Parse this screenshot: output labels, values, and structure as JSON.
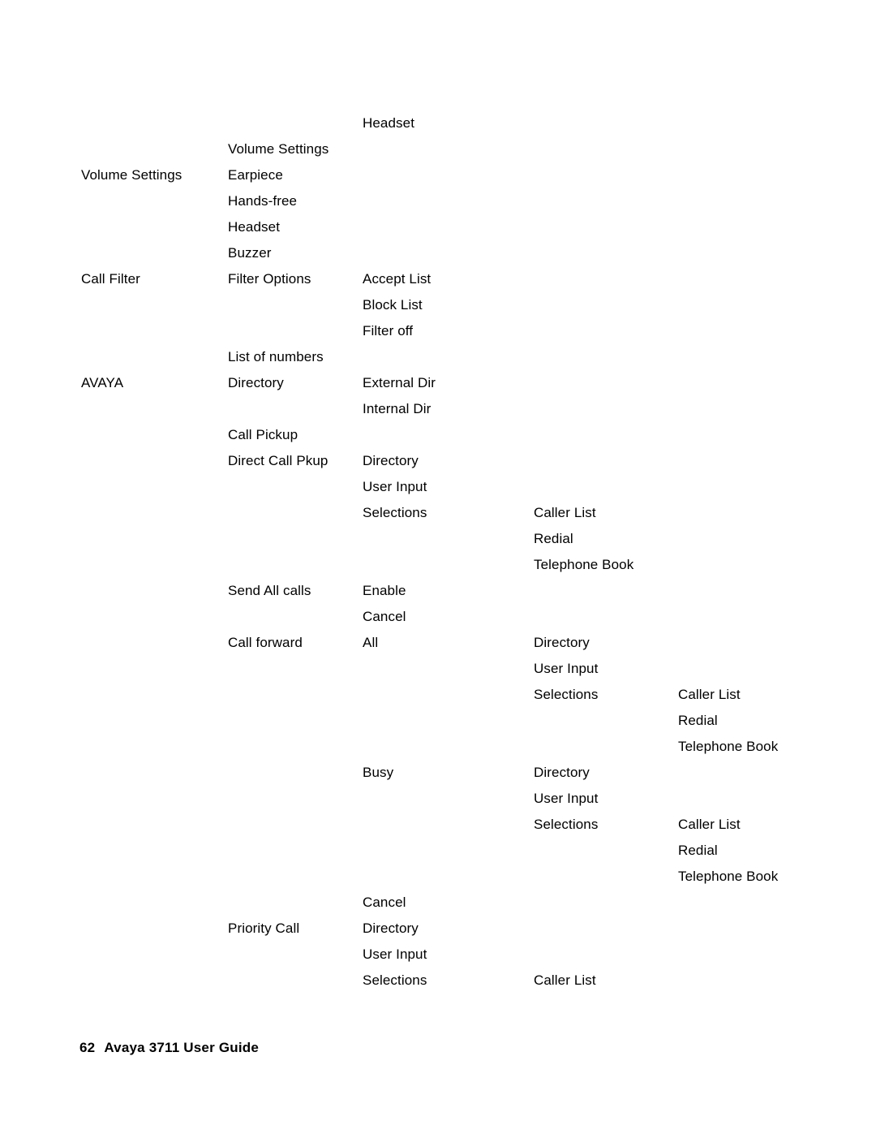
{
  "document": {
    "page_number": "62",
    "footer_title": "Avaya 3711 User Guide",
    "text_color": "#000000",
    "background_color": "#ffffff"
  },
  "menu_tree": {
    "columns": 5,
    "rows": [
      {
        "c1": "",
        "c2": "",
        "c3": "Headset",
        "c4": "",
        "c5": ""
      },
      {
        "c1": "",
        "c2": "Volume Settings",
        "c3": "",
        "c4": "",
        "c5": ""
      },
      {
        "c1": "Volume Settings",
        "c2": "Earpiece",
        "c3": "",
        "c4": "",
        "c5": ""
      },
      {
        "c1": "",
        "c2": "Hands-free",
        "c3": "",
        "c4": "",
        "c5": ""
      },
      {
        "c1": "",
        "c2": "Headset",
        "c3": "",
        "c4": "",
        "c5": ""
      },
      {
        "c1": "",
        "c2": "Buzzer",
        "c3": "",
        "c4": "",
        "c5": ""
      },
      {
        "c1": "Call Filter",
        "c2": "Filter Options",
        "c3": "Accept List",
        "c4": "",
        "c5": ""
      },
      {
        "c1": "",
        "c2": "",
        "c3": "Block List",
        "c4": "",
        "c5": ""
      },
      {
        "c1": "",
        "c2": "",
        "c3": "Filter off",
        "c4": "",
        "c5": ""
      },
      {
        "c1": "",
        "c2": "List of numbers",
        "c3": "",
        "c4": "",
        "c5": ""
      },
      {
        "c1": "AVAYA",
        "c2": "Directory",
        "c3": "External Dir",
        "c4": "",
        "c5": ""
      },
      {
        "c1": "",
        "c2": "",
        "c3": "Internal Dir",
        "c4": "",
        "c5": ""
      },
      {
        "c1": "",
        "c2": "Call Pickup",
        "c3": "",
        "c4": "",
        "c5": ""
      },
      {
        "c1": "",
        "c2": "Direct Call Pkup",
        "c3": "Directory",
        "c4": "",
        "c5": ""
      },
      {
        "c1": "",
        "c2": "",
        "c3": "User Input",
        "c4": "",
        "c5": ""
      },
      {
        "c1": "",
        "c2": "",
        "c3": "Selections",
        "c4": "Caller List",
        "c5": ""
      },
      {
        "c1": "",
        "c2": "",
        "c3": "",
        "c4": "Redial",
        "c5": ""
      },
      {
        "c1": "",
        "c2": "",
        "c3": "",
        "c4": "Telephone Book",
        "c5": ""
      },
      {
        "c1": "",
        "c2": "Send All calls",
        "c3": "Enable",
        "c4": "",
        "c5": ""
      },
      {
        "c1": "",
        "c2": "",
        "c3": "Cancel",
        "c4": "",
        "c5": ""
      },
      {
        "c1": "",
        "c2": "Call forward",
        "c3": "All",
        "c4": "Directory",
        "c5": ""
      },
      {
        "c1": "",
        "c2": "",
        "c3": "",
        "c4": "User Input",
        "c5": ""
      },
      {
        "c1": "",
        "c2": "",
        "c3": "",
        "c4": "Selections",
        "c5": "Caller List"
      },
      {
        "c1": "",
        "c2": "",
        "c3": "",
        "c4": "",
        "c5": "Redial"
      },
      {
        "c1": "",
        "c2": "",
        "c3": "",
        "c4": "",
        "c5": "Telephone Book"
      },
      {
        "c1": "",
        "c2": "",
        "c3": "Busy",
        "c4": "Directory",
        "c5": ""
      },
      {
        "c1": "",
        "c2": "",
        "c3": "",
        "c4": "User Input",
        "c5": ""
      },
      {
        "c1": "",
        "c2": "",
        "c3": "",
        "c4": "Selections",
        "c5": "Caller List"
      },
      {
        "c1": "",
        "c2": "",
        "c3": "",
        "c4": "",
        "c5": "Redial"
      },
      {
        "c1": "",
        "c2": "",
        "c3": "",
        "c4": "",
        "c5": "Telephone Book"
      },
      {
        "c1": "",
        "c2": "",
        "c3": "Cancel",
        "c4": "",
        "c5": ""
      },
      {
        "c1": "",
        "c2": "Priority Call",
        "c3": "Directory",
        "c4": "",
        "c5": ""
      },
      {
        "c1": "",
        "c2": "",
        "c3": "User Input",
        "c4": "",
        "c5": ""
      },
      {
        "c1": "",
        "c2": "",
        "c3": "Selections",
        "c4": "Caller List",
        "c5": ""
      }
    ]
  }
}
